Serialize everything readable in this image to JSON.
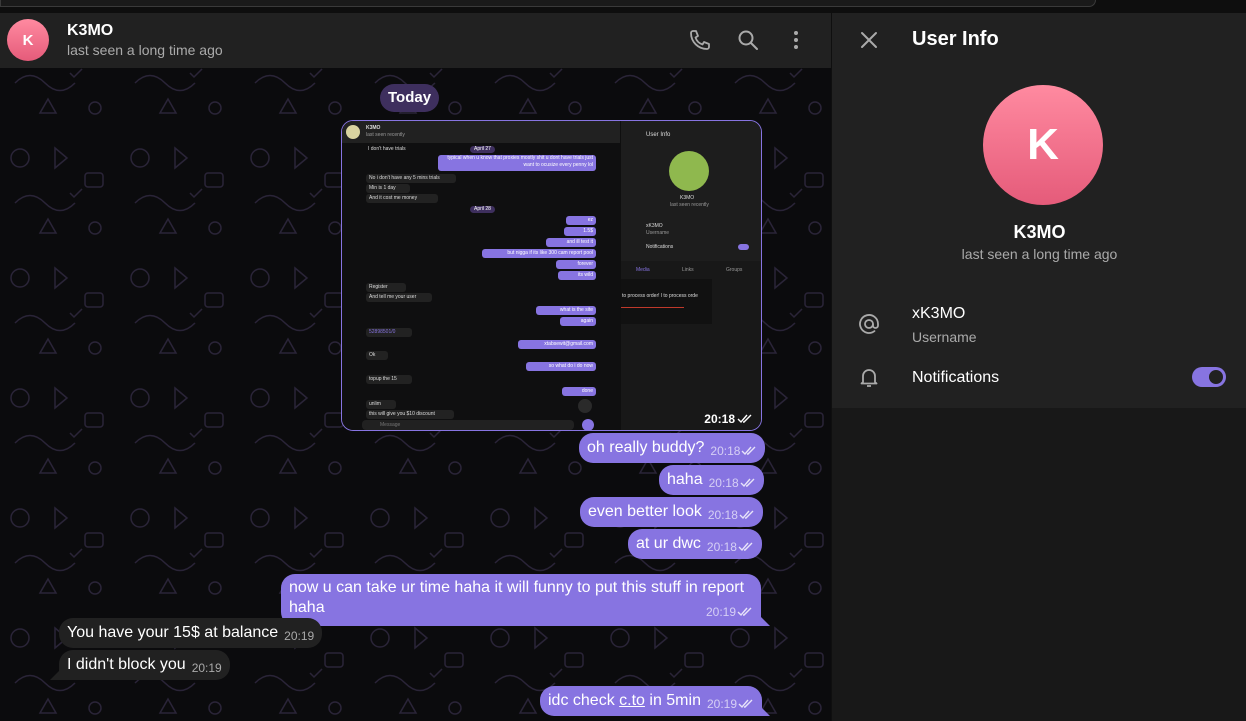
{
  "header": {
    "avatar_letter": "K",
    "name": "K3MO",
    "status": "last seen a long time ago",
    "icons": [
      "phone-icon",
      "search-icon",
      "more-vertical-icon"
    ]
  },
  "chat": {
    "date_label": "Today",
    "image_message": {
      "time": "20:18",
      "mini": {
        "name": "K3MO",
        "status": "last seen recently",
        "panel_title": "User Info",
        "panel_name": "K3MO",
        "panel_status": "last seen recently",
        "panel_username": "xK3MO",
        "panel_username_label": "Username",
        "panel_notifications": "Notifications",
        "tabs": [
          "Media",
          "Links",
          "Groups"
        ],
        "media_text": "to process order! l to process orde",
        "date1": "April 27",
        "date2": "April 28",
        "lines": [
          {
            "dir": "in",
            "text": "I don't have trials"
          },
          {
            "dir": "out",
            "text": "typical when u know that proxies mostly shit u dont have trials just want to ocusize every penny lol"
          },
          {
            "dir": "in",
            "text": "No i don't have any 5 mins trials"
          },
          {
            "dir": "in",
            "text": "Min is 1 day"
          },
          {
            "dir": "in",
            "text": "And it cost me money"
          },
          {
            "dir": "out",
            "text": "ez"
          },
          {
            "dir": "out",
            "text": "1.5$"
          },
          {
            "dir": "out",
            "text": "and ill test it"
          },
          {
            "dir": "out",
            "text": "but nigga if its like 300 cam report pool"
          },
          {
            "dir": "out",
            "text": "forever"
          },
          {
            "dir": "out",
            "text": "its wild"
          },
          {
            "dir": "in",
            "text": "Register"
          },
          {
            "dir": "in",
            "text": "And tell me your user"
          },
          {
            "dir": "out",
            "text": "what is the site"
          },
          {
            "dir": "out",
            "text": "again"
          },
          {
            "dir": "in",
            "text": "52898501/0"
          },
          {
            "dir": "out",
            "text": "xtabsewit@gmail.com"
          },
          {
            "dir": "in",
            "text": "Ok"
          },
          {
            "dir": "out",
            "text": "so what do i do now"
          },
          {
            "dir": "in",
            "text": "topup the 15"
          },
          {
            "dir": "out",
            "text": "done"
          },
          {
            "dir": "in",
            "text": "unlim"
          },
          {
            "dir": "in",
            "text": "this will give you $10 discount"
          }
        ],
        "input_placeholder": "Message"
      }
    },
    "messages": [
      {
        "dir": "out",
        "text": "oh really buddy?",
        "time": "20:18"
      },
      {
        "dir": "out",
        "text": "haha",
        "time": "20:18"
      },
      {
        "dir": "out",
        "text": "even better look",
        "time": "20:18"
      },
      {
        "dir": "out",
        "text": "at ur dwc",
        "time": "20:18"
      },
      {
        "dir": "out",
        "text_line1": "now u can take ur time haha it will funny to put this stuff in report",
        "text_line2": "haha",
        "time": "20:19"
      },
      {
        "dir": "in",
        "text": "You have your 15$ at balance",
        "time": "20:19"
      },
      {
        "dir": "in",
        "text": "I didn't block you",
        "time": "20:19"
      },
      {
        "dir": "out",
        "text_pre": "idc check ",
        "link": "c.to",
        "text_post": " in 5min",
        "time": "20:19"
      }
    ]
  },
  "panel": {
    "title": "User Info",
    "avatar_letter": "K",
    "name": "K3MO",
    "status": "last seen a long time ago",
    "username": "xK3MO",
    "username_label": "Username",
    "notifications_label": "Notifications",
    "notifications_on": true
  },
  "colors": {
    "accent": "#8774e1",
    "avatar_gradient_top": "#ff8aa0",
    "avatar_gradient_bottom": "#e55b7a",
    "header_bg": "#212121"
  }
}
